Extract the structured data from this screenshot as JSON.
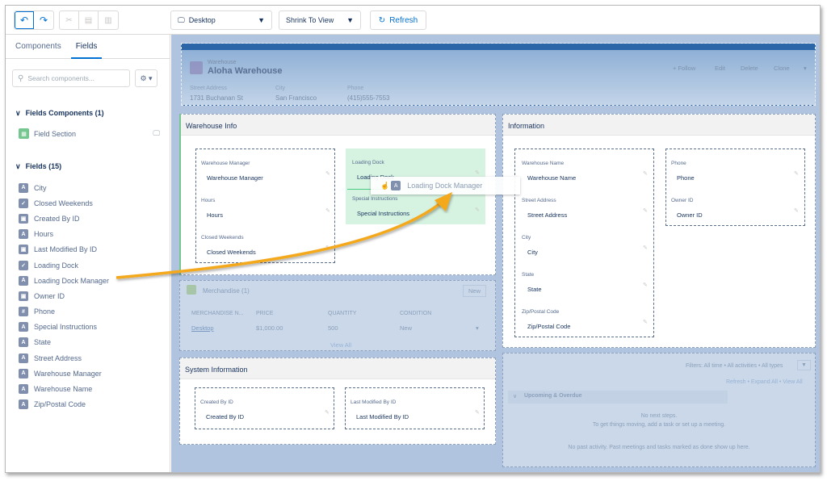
{
  "toolbar": {
    "undo_icon": "↶",
    "redo_icon": "↷",
    "cut_icon": "✂",
    "copy_icon": "▤",
    "paste_icon": "▥",
    "device_icon": "🖵",
    "device_select": "Desktop",
    "zoom_select": "Shrink To View",
    "refresh_icon": "↻",
    "refresh_label": "Refresh"
  },
  "left_panel": {
    "tabs": [
      {
        "label": "Components"
      },
      {
        "label": "Fields",
        "active": true
      }
    ],
    "search_placeholder": "Search components...",
    "settings_icon": "⚙ ▾",
    "field_components_header": "Fields Components (1)",
    "field_components": [
      {
        "label": "Field Section",
        "icon": "section"
      }
    ],
    "fields_header": "Fields (15)",
    "fields": [
      {
        "label": "City",
        "type": "A"
      },
      {
        "label": "Closed Weekends",
        "type": "✓"
      },
      {
        "label": "Created By ID",
        "type": "▣"
      },
      {
        "label": "Hours",
        "type": "A"
      },
      {
        "label": "Last Modified By ID",
        "type": "▣"
      },
      {
        "label": "Loading Dock",
        "type": "✓"
      },
      {
        "label": "Loading Dock Manager",
        "type": "A"
      },
      {
        "label": "Owner ID",
        "type": "▣"
      },
      {
        "label": "Phone",
        "type": "#"
      },
      {
        "label": "Special Instructions",
        "type": "A"
      },
      {
        "label": "State",
        "type": "A"
      },
      {
        "label": "Street Address",
        "type": "A"
      },
      {
        "label": "Warehouse Manager",
        "type": "A"
      },
      {
        "label": "Warehouse Name",
        "type": "A"
      },
      {
        "label": "Zip/Postal Code",
        "type": "A"
      }
    ]
  },
  "record_header": {
    "object_type": "Warehouse",
    "title": "Aloha Warehouse",
    "fields": [
      {
        "label": "Street Address",
        "value": "1731 Buchanan St"
      },
      {
        "label": "City",
        "value": "San Francisco"
      },
      {
        "label": "Phone",
        "value": "(415)555-7553"
      }
    ],
    "actions": [
      "+ Follow",
      "Edit",
      "Delete",
      "Clone",
      "▾"
    ]
  },
  "warehouse_info": {
    "title": "Warehouse Info",
    "left_col": [
      {
        "label": "Warehouse Manager",
        "value": "Warehouse Manager"
      },
      {
        "label": "Hours",
        "value": "Hours"
      },
      {
        "label": "Closed Weekends",
        "value": "Closed Weekends"
      }
    ],
    "right_col": [
      {
        "label": "Loading Dock",
        "value": "Loading Dock"
      },
      {
        "label": "Special Instructions",
        "value": "Special Instructions"
      }
    ]
  },
  "drag_item": {
    "label": "Loading Dock Manager",
    "type": "A"
  },
  "merchandise": {
    "title": "Merchandise (1)",
    "new_label": "New",
    "columns": [
      "MERCHANDISE N...",
      "PRICE",
      "QUANTITY",
      "CONDITION"
    ],
    "rows": [
      [
        "Desktop",
        "$1,000.00",
        "500",
        "New"
      ]
    ],
    "view_all": "View All"
  },
  "system_info": {
    "title": "System Information",
    "left": {
      "label": "Created By ID",
      "value": "Created By ID"
    },
    "right": {
      "label": "Last Modified By ID",
      "value": "Last Modified By ID"
    }
  },
  "information": {
    "title": "Information",
    "left_col": [
      {
        "label": "Warehouse Name",
        "value": "Warehouse Name"
      },
      {
        "label": "Street Address",
        "value": "Street Address"
      },
      {
        "label": "City",
        "value": "City"
      },
      {
        "label": "State",
        "value": "State"
      },
      {
        "label": "Zip/Postal Code",
        "value": "Zip/Postal Code"
      }
    ],
    "right_col": [
      {
        "label": "Phone",
        "value": "Phone"
      },
      {
        "label": "Owner ID",
        "value": "Owner ID"
      }
    ]
  },
  "activity": {
    "filters": "Filters: All time • All activities • All types",
    "links": "Refresh • Expand All • View All",
    "upcoming_header": "Upcoming & Overdue",
    "no_next_steps": "No next steps.",
    "no_next_steps_hint": "To get things moving, add a task or set up a meeting.",
    "no_past": "No past activity. Past meetings and tasks marked as done show up here."
  },
  "colors": {
    "accent": "#0070d2",
    "arrow": "#f4a81d",
    "drop_zone": "#d6f2e1",
    "canvas_bg": "#b0c4df"
  }
}
